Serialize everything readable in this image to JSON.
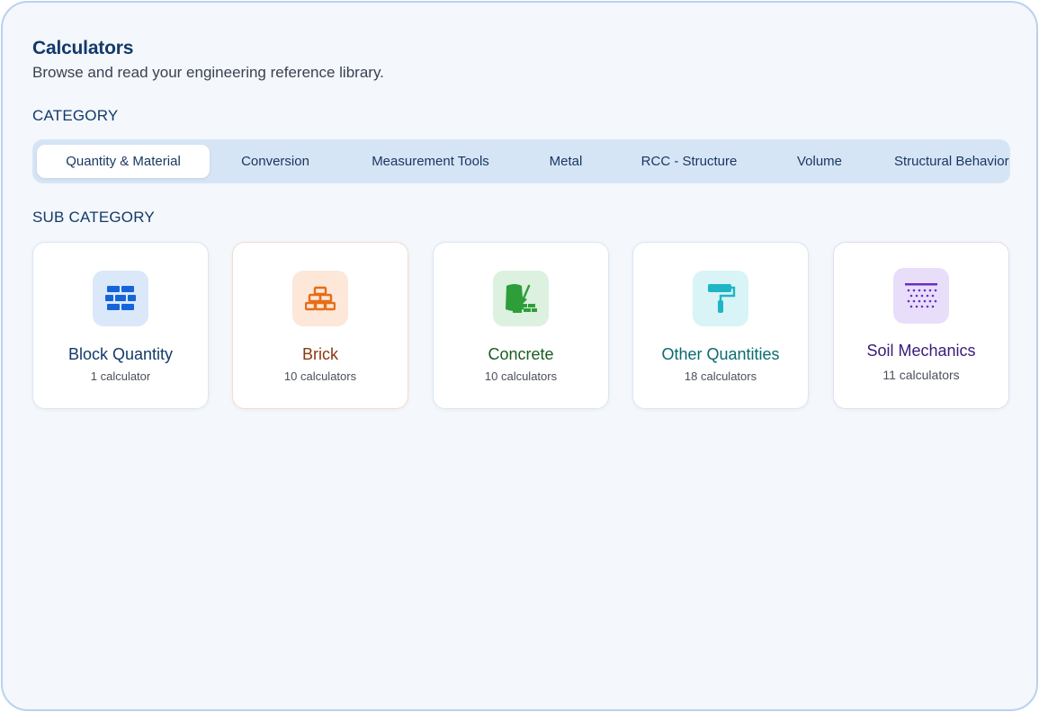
{
  "header": {
    "title": "Calculators",
    "subtitle": "Browse and read your engineering reference library."
  },
  "category": {
    "label": "CATEGORY",
    "tabs": [
      {
        "label": "Quantity & Material",
        "active": true
      },
      {
        "label": "Conversion",
        "active": false
      },
      {
        "label": "Measurement Tools",
        "active": false
      },
      {
        "label": "Metal",
        "active": false
      },
      {
        "label": "RCC - Structure",
        "active": false
      },
      {
        "label": "Volume",
        "active": false
      },
      {
        "label": "Structural Behavior",
        "active": false
      }
    ]
  },
  "subcategory": {
    "label": "SUB CATEGORY",
    "cards": [
      {
        "title": "Block Quantity",
        "count": "1 calculator",
        "icon": "block-wall-icon",
        "color": "#123a6b",
        "icon_color": "#1565d8",
        "tile_bg": "#dbe8fa"
      },
      {
        "title": "Brick",
        "count": "10 calculators",
        "icon": "brick-stack-icon",
        "color": "#8a3a10",
        "icon_color": "#e66d17",
        "tile_bg": "#fde7d8"
      },
      {
        "title": "Concrete",
        "count": "10 calculators",
        "icon": "concrete-bag-icon",
        "color": "#1b5e20",
        "icon_color": "#2e9e3a",
        "tile_bg": "#dcf1df"
      },
      {
        "title": "Other Quantities",
        "count": "18 calculators",
        "icon": "paint-roller-icon",
        "color": "#0b6b6e",
        "icon_color": "#1fb5c4",
        "tile_bg": "#d8f4f6"
      },
      {
        "title": "Soil Mechanics",
        "count": "11 calculators",
        "icon": "soil-layer-icon",
        "color": "#3b1a7a",
        "icon_color": "#6a2ec2",
        "tile_bg": "#e8defa"
      }
    ]
  }
}
